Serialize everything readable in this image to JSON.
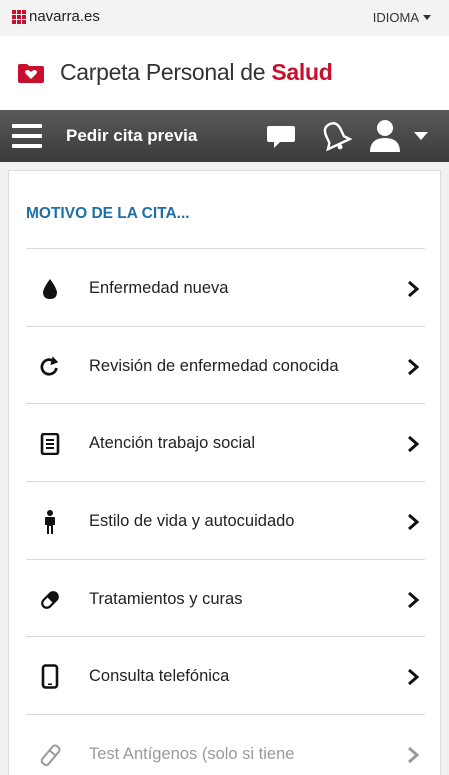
{
  "topbar": {
    "brand": "navarra.es",
    "language": "IDIOMA"
  },
  "header": {
    "title_prefix": "Carpeta Personal de ",
    "title_emphasis": "Salud"
  },
  "navbar": {
    "title": "Pedir cita previa"
  },
  "main": {
    "section_title": "MOTIVO DE LA CITA...",
    "items": [
      {
        "label": "Enfermedad nueva",
        "icon": "drop-icon"
      },
      {
        "label": "Revisión de enfermedad conocida",
        "icon": "refresh-icon"
      },
      {
        "label": "Atención trabajo social",
        "icon": "document-icon"
      },
      {
        "label": "Estilo de vida y autocuidado",
        "icon": "person-icon"
      },
      {
        "label": "Tratamientos y curas",
        "icon": "bandage-icon"
      },
      {
        "label": "Consulta telefónica",
        "icon": "phone-icon"
      },
      {
        "label": "Test Antígenos (solo si tiene",
        "icon": "swab-icon"
      }
    ]
  },
  "colors": {
    "brand_red": "#c8102e",
    "section_blue": "#1d6fa5",
    "navbar": "#4a4a4a"
  }
}
